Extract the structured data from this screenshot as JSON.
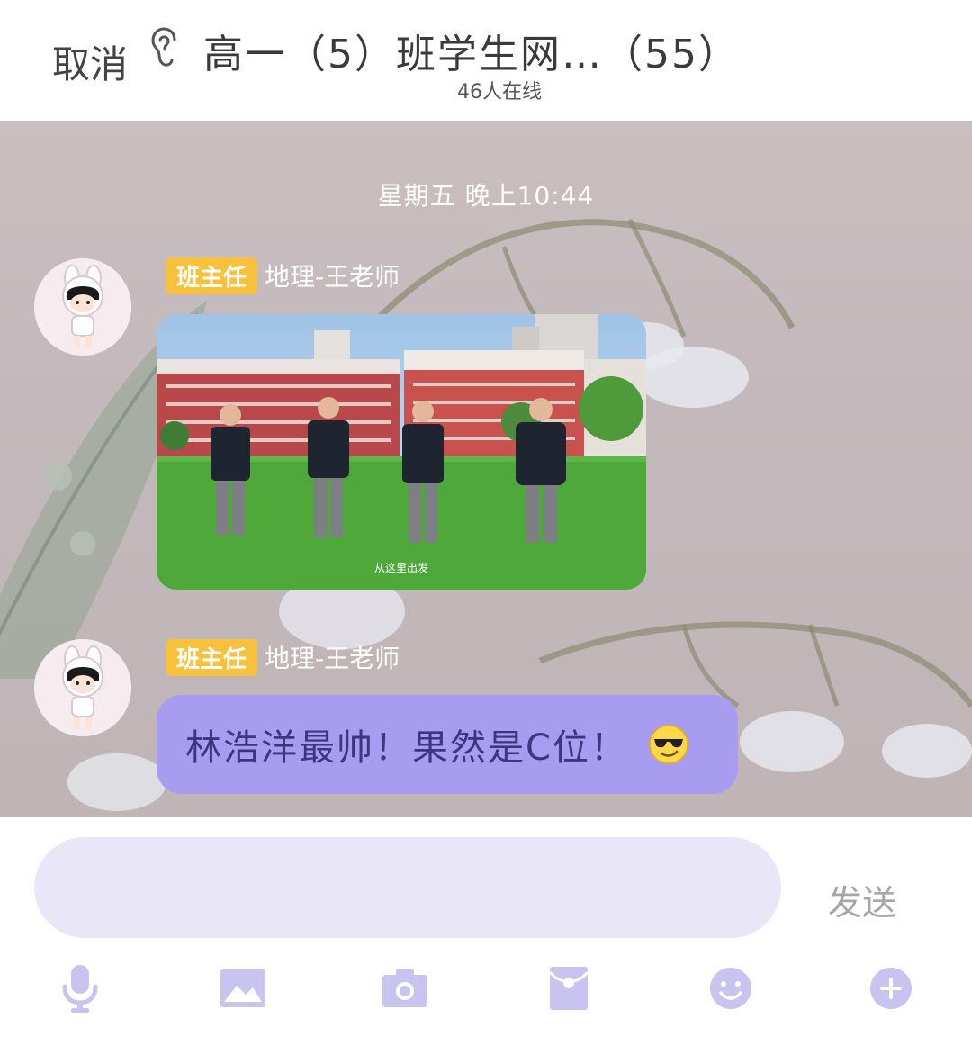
{
  "header": {
    "cancel_label": "取消",
    "title": "高一（5）班学生网…（55）",
    "online_status": "46人在线"
  },
  "chat": {
    "timestamp": "星期五 晚上10:44",
    "messages": [
      {
        "role_badge": "班主任",
        "sender_name": "地理-王老师",
        "type": "image",
        "image_caption": "从这里出发"
      },
      {
        "role_badge": "班主任",
        "sender_name": "地理-王老师",
        "type": "text",
        "text": "林浩洋最帅！果然是C位！",
        "emoji": "cool-sunglasses-emoji"
      }
    ]
  },
  "composer": {
    "input_value": "",
    "send_label": "发送"
  },
  "toolbar": {
    "icons": [
      "microphone-icon",
      "picture-icon",
      "camera-icon",
      "red-packet-icon",
      "smile-icon",
      "plus-icon"
    ]
  },
  "colors": {
    "bubble": "#a89cf0",
    "badge": "#f7c13c",
    "toolbar_icon": "#c9c3f0"
  }
}
